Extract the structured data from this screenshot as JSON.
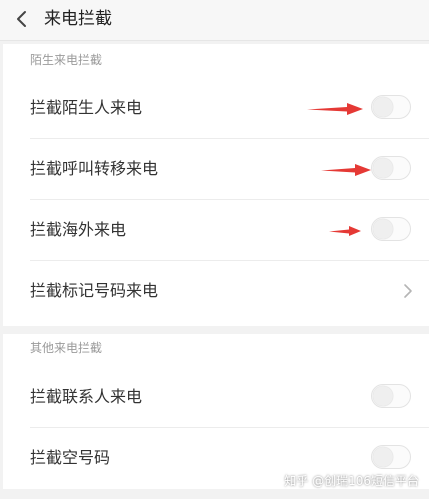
{
  "header": {
    "title": "来电拦截",
    "back_icon": "chevron-left-icon"
  },
  "sections": [
    {
      "label": "陌生来电拦截",
      "items": [
        {
          "label": "拦截陌生人来电",
          "control": "toggle",
          "on": false
        },
        {
          "label": "拦截呼叫转移来电",
          "control": "toggle",
          "on": false
        },
        {
          "label": "拦截海外来电",
          "control": "toggle",
          "on": false
        },
        {
          "label": "拦截标记号码来电",
          "control": "chevron-right-icon"
        }
      ]
    },
    {
      "label": "其他来电拦截",
      "items": [
        {
          "label": "拦截联系人来电",
          "control": "toggle",
          "on": false
        },
        {
          "label": "拦截空号码",
          "control": "toggle",
          "on": false
        }
      ]
    }
  ],
  "annotations": {
    "arrow_color": "#e53935",
    "arrow_icon": "red-arrow-icon"
  },
  "watermark": {
    "text": "知乎 @创瑞106短信平台"
  }
}
